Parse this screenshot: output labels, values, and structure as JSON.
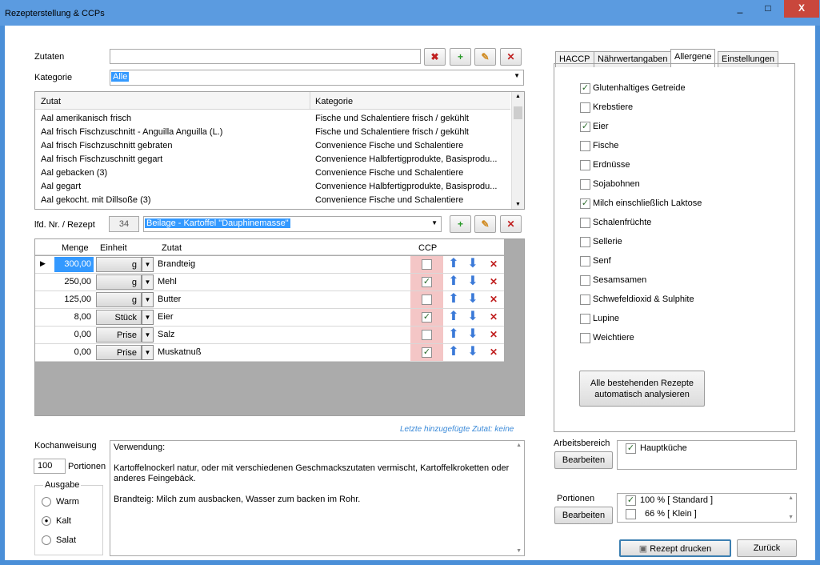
{
  "window": {
    "title": "Rezepterstellung & CCPs",
    "min": "_",
    "max": "□",
    "close": "X"
  },
  "zutaten": {
    "label": "Zutaten",
    "value": ""
  },
  "kategorie": {
    "label": "Kategorie",
    "value": "Alle"
  },
  "ingredient_list": {
    "headers": [
      "Zutat",
      "Kategorie"
    ],
    "rows": [
      [
        "Aal amerikanisch frisch",
        "Fische und Schalentiere frisch / gekühlt"
      ],
      [
        "Aal frisch Fischzuschnitt - Anguilla Anguilla (L.)",
        "Fische und Schalentiere frisch / gekühlt"
      ],
      [
        "Aal frisch Fischzuschnitt gebraten",
        "Convenience Fische und Schalentiere"
      ],
      [
        "Aal frisch Fischzuschnitt gegart",
        "Convenience Halbfertigprodukte, Basisprodu..."
      ],
      [
        "Aal gebacken (3)",
        "Convenience Fische und Schalentiere"
      ],
      [
        "Aal gegart",
        "Convenience Halbfertigprodukte, Basisprodu..."
      ],
      [
        "Aal gekocht. mit Dillsoße (3)",
        "Convenience Fische und Schalentiere"
      ]
    ]
  },
  "rezept": {
    "label": "lfd. Nr. / Rezept",
    "number": "34",
    "name": "Beilage - Kartoffel \"Dauphinemasse\""
  },
  "recipe_grid": {
    "headers": {
      "menge": "Menge",
      "einheit": "Einheit",
      "zutat": "Zutat",
      "ccp": "CCP"
    },
    "rows": [
      {
        "menge": "300,00",
        "einheit": "g",
        "zutat": "Brandteig",
        "ccp": false
      },
      {
        "menge": "250,00",
        "einheit": "g",
        "zutat": "Mehl",
        "ccp": true
      },
      {
        "menge": "125,00",
        "einheit": "g",
        "zutat": "Butter",
        "ccp": false
      },
      {
        "menge": "8,00",
        "einheit": "Stück",
        "zutat": "Eier",
        "ccp": true
      },
      {
        "menge": "0,00",
        "einheit": "Prise",
        "zutat": "Salz",
        "ccp": false
      },
      {
        "menge": "0,00",
        "einheit": "Prise",
        "zutat": "Muskatnuß",
        "ccp": true
      }
    ]
  },
  "letzte_zutat": "Letzte hinzugefügte Zutat: keine",
  "kochanweisung": {
    "label": "Kochanweisung",
    "text_lines": [
      "Verwendung:",
      "",
      "Kartoffelnockerl natur, oder mit verschiedenen Geschmackszutaten vermischt, Kartoffelkroketten oder",
      "anderes Feingebäck.",
      "",
      "Brandteig: Milch zum ausbacken, Wasser zum backen im Rohr."
    ]
  },
  "portionen_input": {
    "value": "100",
    "label": "Portionen"
  },
  "ausgabe": {
    "label": "Ausgabe",
    "options": [
      {
        "label": "Warm",
        "checked": false
      },
      {
        "label": "Kalt",
        "checked": true
      },
      {
        "label": "Salat",
        "checked": false
      }
    ]
  },
  "tabs": [
    "HACCP",
    "Nährwertangaben",
    "Allergene",
    "Einstellungen"
  ],
  "active_tab": "Allergene",
  "allergene": [
    {
      "label": "Glutenhaltiges Getreide",
      "checked": true
    },
    {
      "label": "Krebstiere",
      "checked": false
    },
    {
      "label": "Eier",
      "checked": true
    },
    {
      "label": "Fische",
      "checked": false
    },
    {
      "label": "Erdnüsse",
      "checked": false
    },
    {
      "label": "Sojabohnen",
      "checked": false
    },
    {
      "label": "Milch einschließlich Laktose",
      "checked": true
    },
    {
      "label": "Schalenfrüchte",
      "checked": false
    },
    {
      "label": "Sellerie",
      "checked": false
    },
    {
      "label": "Senf",
      "checked": false
    },
    {
      "label": "Sesamsamen",
      "checked": false
    },
    {
      "label": "Schwefeldioxid & Sulphite",
      "checked": false
    },
    {
      "label": "Lupine",
      "checked": false
    },
    {
      "label": "Weichtiere",
      "checked": false
    }
  ],
  "analyse_button": {
    "line1": "Alle bestehenden Rezepte",
    "line2": "automatisch analysieren"
  },
  "arbeitsbereich": {
    "label": "Arbeitsbereich",
    "button": "Bearbeiten",
    "items": [
      {
        "label": "Hauptküche",
        "checked": true
      }
    ]
  },
  "portionen_panel": {
    "label": "Portionen",
    "button": "Bearbeiten",
    "items": [
      {
        "label": "100 % [ Standard ]",
        "checked": true
      },
      {
        "label": "66 % [ Klein ]",
        "checked": false
      }
    ]
  },
  "footer": {
    "print": "Rezept drucken",
    "back": "Zurück"
  },
  "colors": {
    "title_bar": "#5b9be0",
    "selection": "#3399ff",
    "ccp_bg": "#f4c6c6",
    "close": "#c9473c"
  }
}
